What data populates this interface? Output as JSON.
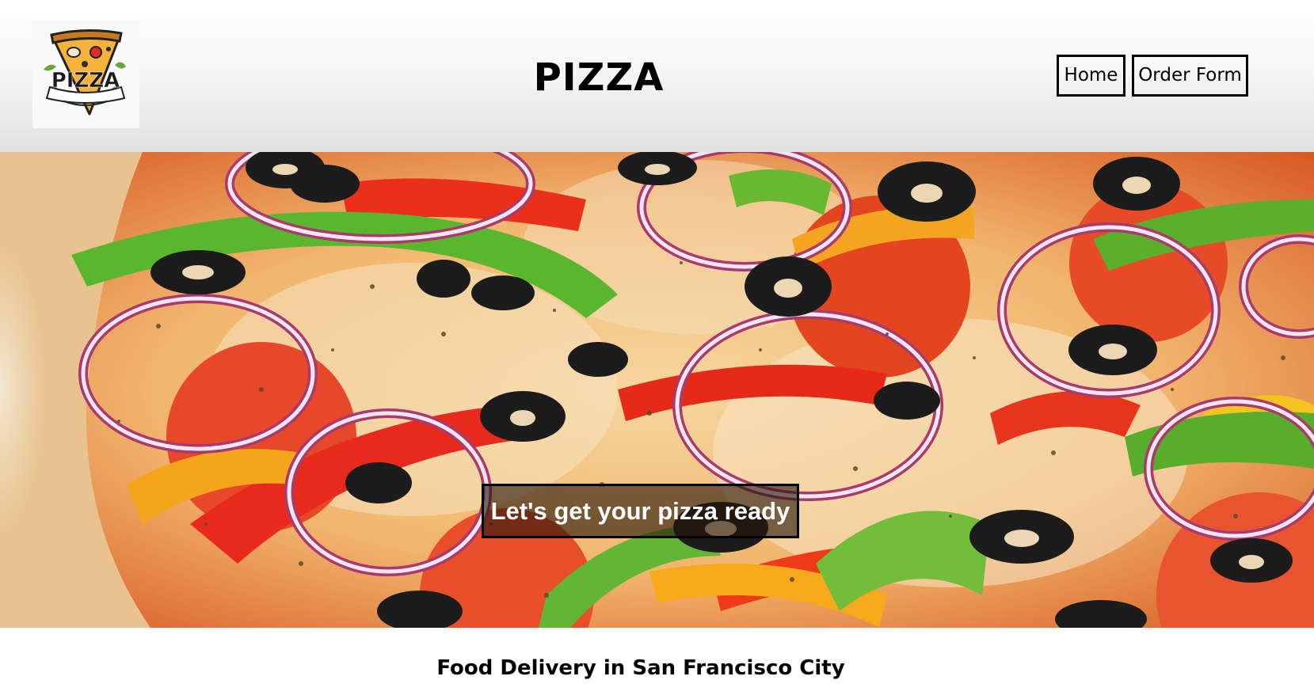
{
  "header": {
    "logo_text": "PIZZA",
    "site_title": "PIZZA",
    "nav": {
      "home_label": "Home",
      "order_label": "Order Form"
    }
  },
  "hero": {
    "caption": "Let's get your pizza ready",
    "image_description_icon": "pizza-photo"
  },
  "main": {
    "subheading": "Food Delivery in San Francisco City"
  },
  "colors": {
    "header_gradient_top": "#ffffff",
    "header_gradient_bottom": "#e1e1e1",
    "caption_bg": "#28160a",
    "text": "#000000"
  }
}
